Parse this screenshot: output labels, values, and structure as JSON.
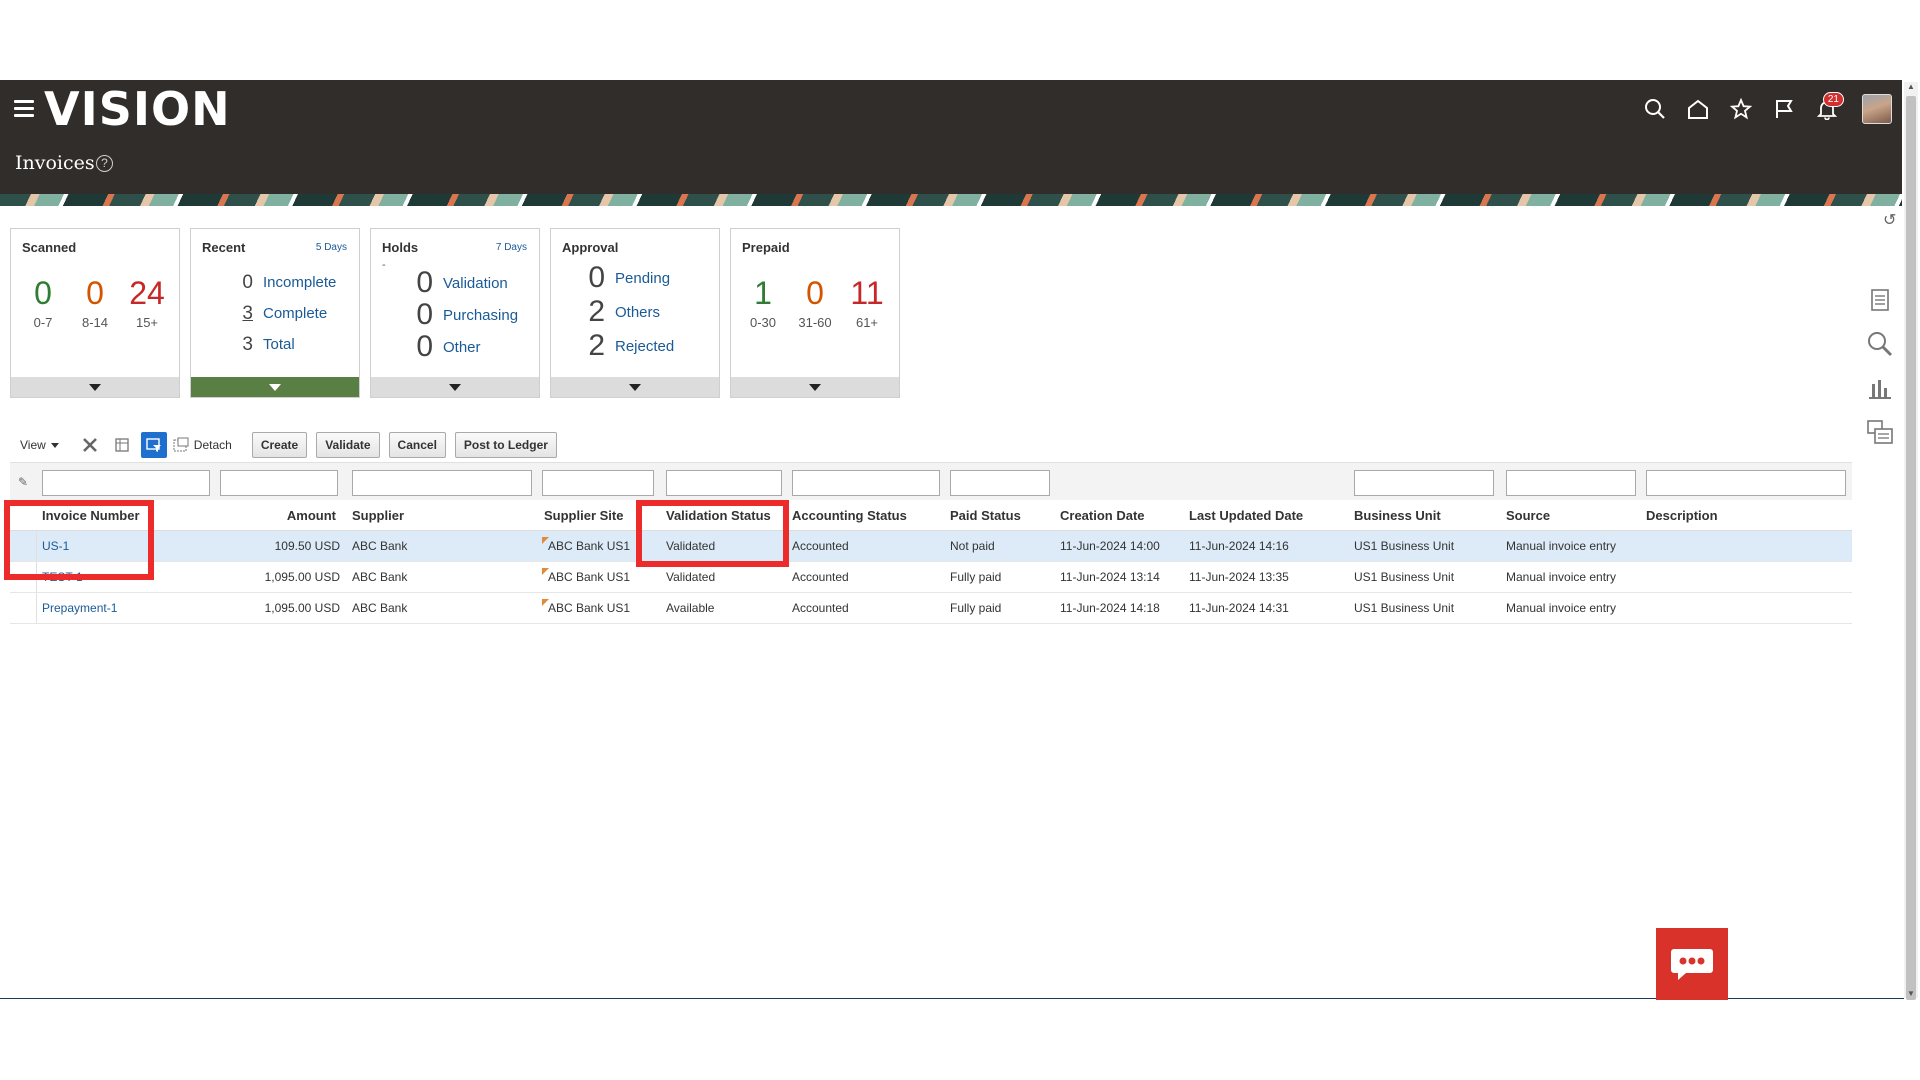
{
  "header": {
    "logo": "VISION",
    "page_title": "Invoices",
    "help": "?",
    "notification_count": "21",
    "icons": [
      "search-icon",
      "home-icon",
      "star-icon",
      "flag-icon",
      "bell-icon"
    ],
    "background": "#312d2a"
  },
  "tiles": {
    "scanned": {
      "title": "Scanned",
      "buckets": [
        {
          "count": "0",
          "label": "0-7",
          "color": "#2e7d32"
        },
        {
          "count": "0",
          "label": "8-14",
          "color": "#d35400"
        },
        {
          "count": "24",
          "label": "15+",
          "color": "#c62828"
        }
      ]
    },
    "recent": {
      "title": "Recent",
      "days": "5 Days",
      "rows": [
        {
          "count": "0",
          "label": "Incomplete"
        },
        {
          "count": "3",
          "label": "Complete"
        },
        {
          "count": "3",
          "label": "Total"
        }
      ]
    },
    "holds": {
      "title": "Holds",
      "days": "7 Days",
      "dash": "-",
      "rows": [
        {
          "count": "0",
          "label": "Validation"
        },
        {
          "count": "0",
          "label": "Purchasing"
        },
        {
          "count": "0",
          "label": "Other"
        }
      ]
    },
    "approval": {
      "title": "Approval",
      "rows": [
        {
          "count": "0",
          "label": "Pending"
        },
        {
          "count": "2",
          "label": "Others"
        },
        {
          "count": "2",
          "label": "Rejected"
        }
      ]
    },
    "prepaid": {
      "title": "Prepaid",
      "buckets": [
        {
          "count": "1",
          "label": "0-30",
          "color": "#2e7d32"
        },
        {
          "count": "0",
          "label": "31-60",
          "color": "#d35400"
        },
        {
          "count": "11",
          "label": "61+",
          "color": "#c62828"
        }
      ]
    }
  },
  "toolbar": {
    "view_label": "View",
    "detach_label": "Detach",
    "create_label": "Create",
    "validate_label": "Validate",
    "cancel_label": "Cancel",
    "post_label": "Post to Ledger"
  },
  "table": {
    "columns": [
      "Invoice Number",
      "Amount",
      "Supplier",
      "Supplier Site",
      "Validation Status",
      "Accounting Status",
      "Paid Status",
      "Creation Date",
      "Last Updated Date",
      "Business Unit",
      "Source",
      "Description"
    ],
    "rows": [
      {
        "invoice": "US-1",
        "amount": "109.50 USD",
        "supplier": "ABC Bank",
        "site": "ABC Bank US1",
        "validation": "Validated",
        "accounting": "Accounted",
        "paid": "Not paid",
        "created": "11-Jun-2024 14:00",
        "updated": "11-Jun-2024 14:16",
        "bu": "US1 Business Unit",
        "source": "Manual invoice entry",
        "description": ""
      },
      {
        "invoice": "TEST-1",
        "amount": "1,095.00 USD",
        "supplier": "ABC Bank",
        "site": "ABC Bank US1",
        "validation": "Validated",
        "accounting": "Accounted",
        "paid": "Fully paid",
        "created": "11-Jun-2024 13:14",
        "updated": "11-Jun-2024 13:35",
        "bu": "US1 Business Unit",
        "source": "Manual invoice entry",
        "description": ""
      },
      {
        "invoice": "Prepayment-1",
        "amount": "1,095.00 USD",
        "supplier": "ABC Bank",
        "site": "ABC Bank US1",
        "validation": "Available",
        "accounting": "Accounted",
        "paid": "Fully paid",
        "created": "11-Jun-2024 14:18",
        "updated": "11-Jun-2024 14:31",
        "bu": "US1 Business Unit",
        "source": "Manual invoice entry",
        "description": ""
      }
    ]
  },
  "colors": {
    "link": "#1a5a96",
    "selected_row": "#dcebf7",
    "highlight": "#ee2b2b",
    "chat_button": "#d8322a"
  }
}
